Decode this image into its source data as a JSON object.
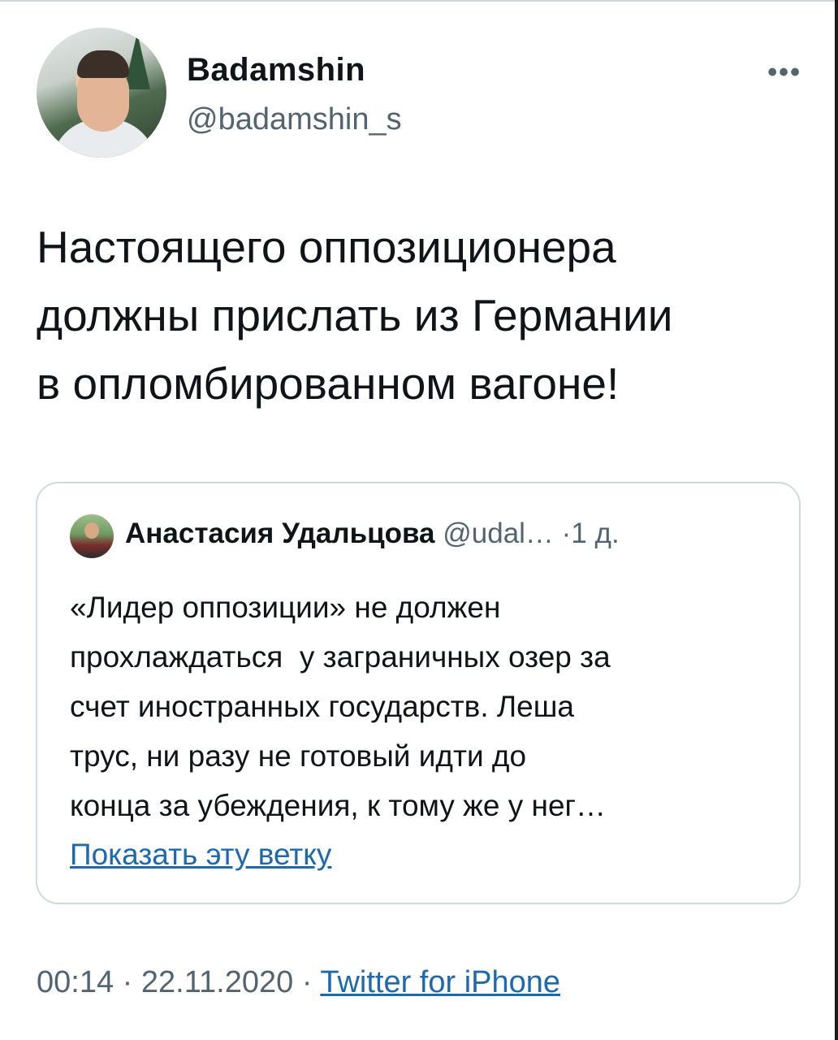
{
  "tweet": {
    "author_name": "Badamshin",
    "author_handle": "@badamshin_s",
    "more_icon": "more-horizontal-icon",
    "text_lines": [
      "Настоящего оппозиционера",
      "должны прислать из Германии",
      "в опломбированном вагоне!"
    ]
  },
  "quote": {
    "author_name": "Анастасия Удальцова",
    "author_handle": "@udal…",
    "separator": "·",
    "time": "1 д.",
    "text_lines": [
      "«Лидер оппозиции» не должен",
      "прохлаждаться  у заграничных озер за",
      "счет иностранных государств. Леша",
      "трус, ни разу не готовый идти до",
      "конца за убеждения, к тому же у нег…"
    ],
    "show_thread": "Показать эту ветку"
  },
  "footer": {
    "time": "00:14",
    "sep1": "·",
    "date": "22.11.2020",
    "sep2": "·",
    "source": "Twitter for iPhone"
  },
  "colors": {
    "text": "#0f1419",
    "secondary": "#536471",
    "link": "#1d69b0",
    "border": "#cfd9de"
  }
}
